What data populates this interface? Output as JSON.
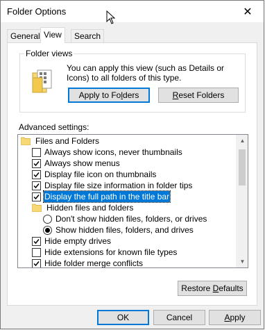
{
  "window": {
    "title": "Folder Options",
    "close_glyph": "✕"
  },
  "tabs": [
    {
      "label": "General",
      "active": false
    },
    {
      "label": "View",
      "active": true
    },
    {
      "label": "Search",
      "active": false
    }
  ],
  "folder_views": {
    "title": "Folder views",
    "description": "You can apply this view (such as Details or Icons) to all folders of this type.",
    "apply_btn": {
      "pre": "Apply to Fo",
      "u": "l",
      "post": "ders"
    },
    "reset_btn": {
      "pre": "",
      "u": "R",
      "post": "eset Folders"
    }
  },
  "advanced": {
    "label": "Advanced settings:",
    "items": [
      {
        "kind": "folder",
        "label": "Files and Folders",
        "indent": 0
      },
      {
        "kind": "check",
        "label": "Always show icons, never thumbnails",
        "checked": false,
        "indent": 1
      },
      {
        "kind": "check",
        "label": "Always show menus",
        "checked": true,
        "indent": 1
      },
      {
        "kind": "check",
        "label": "Display file icon on thumbnails",
        "checked": true,
        "indent": 1
      },
      {
        "kind": "check",
        "label": "Display file size information in folder tips",
        "checked": true,
        "indent": 1
      },
      {
        "kind": "check",
        "label": "Display the full path in the title bar",
        "checked": true,
        "indent": 1,
        "selected": true
      },
      {
        "kind": "folder",
        "label": "Hidden files and folders",
        "indent": 1
      },
      {
        "kind": "radio",
        "label": "Don't show hidden files, folders, or drives",
        "checked": false,
        "indent": 2
      },
      {
        "kind": "radio",
        "label": "Show hidden files, folders, and drives",
        "checked": true,
        "indent": 2
      },
      {
        "kind": "check",
        "label": "Hide empty drives",
        "checked": true,
        "indent": 1
      },
      {
        "kind": "check",
        "label": "Hide extensions for known file types",
        "checked": false,
        "indent": 1
      },
      {
        "kind": "check",
        "label": "Hide folder merge conflicts",
        "checked": true,
        "indent": 1
      }
    ]
  },
  "restore_btn": {
    "pre": "Restore ",
    "u": "D",
    "post": "efaults"
  },
  "footer": {
    "ok": "OK",
    "cancel": "Cancel",
    "apply": {
      "pre": "",
      "u": "A",
      "post": "pply"
    }
  },
  "colors": {
    "selection": "#0078d7",
    "accent_border": "#0078d7",
    "folder": "#f8d775"
  }
}
